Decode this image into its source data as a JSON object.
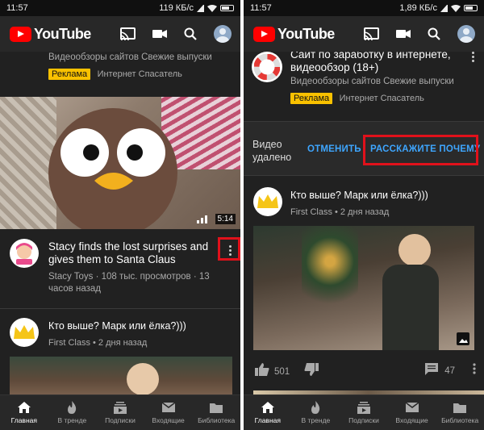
{
  "status_left": {
    "time": "11:57",
    "speed": "119 КБ/с"
  },
  "status_right": {
    "time": "11:57",
    "speed": "1,89 КБ/с"
  },
  "app": {
    "logo_text": "YouTube"
  },
  "left_feed": {
    "ad_text": "Видеообзоры сайтов Свежие выпуски",
    "ad_badge": "Реклама",
    "ad_channel": "Интернет Спасатель",
    "video": {
      "duration": "5:14",
      "title": "Stacy finds the lost surprises and gives them to Santa Claus",
      "meta": "Stacy Toys · 108 тыс. просмотров · 13 часов назад"
    },
    "post": {
      "text": "Кто выше? Марк или ёлка?)))",
      "meta": "First Class • 2 дня назад"
    }
  },
  "right_feed": {
    "ad_title": "Сайт по заработку в интернете, видеообзор (18+)",
    "ad_text": "Видеообзоры сайтов Свежие выпуски",
    "ad_badge": "Реклама",
    "ad_channel": "Интернет Спасатель",
    "removed_label": "Видео удалено",
    "undo_label": "ОТМЕНИТЬ",
    "tell_why_label": "РАССКАЖИТЕ ПОЧЕМУ",
    "post": {
      "text": "Кто выше? Марк или ёлка?)))",
      "meta": "First Class • 2 дня назад",
      "likes": "501",
      "comments": "47"
    }
  },
  "nav": {
    "home": "Главная",
    "trending": "В тренде",
    "subscriptions": "Подписки",
    "inbox": "Входящие",
    "library": "Библиотека"
  },
  "colors": {
    "accent_blue": "#3ea6ff",
    "highlight_red": "#e0111b",
    "ad_yellow": "#f9c100"
  }
}
